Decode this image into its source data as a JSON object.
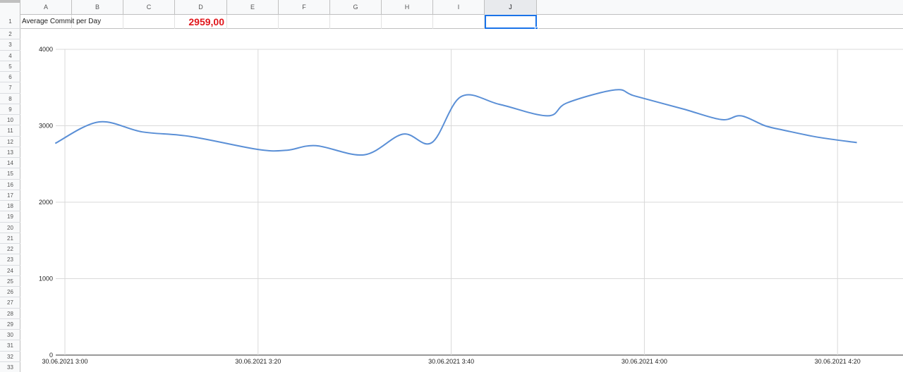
{
  "columns": [
    "A",
    "B",
    "C",
    "D",
    "E",
    "F",
    "G",
    "H",
    "I",
    "J"
  ],
  "selected_column": "J",
  "rows": [
    "1",
    "2",
    "3",
    "4",
    "5",
    "6",
    "7",
    "8",
    "9",
    "10",
    "11",
    "12",
    "13",
    "14",
    "15",
    "16",
    "17",
    "18",
    "19",
    "20",
    "21",
    "22",
    "23",
    "24",
    "25",
    "26",
    "27",
    "28",
    "29",
    "30",
    "31",
    "32",
    "33"
  ],
  "cells": {
    "a1": "Average Commit per Day",
    "d1": "2959,00"
  },
  "colors": {
    "line": "#5a8fd6",
    "highlight_value": "#e0161b",
    "selection": "#1a73e8"
  },
  "chart_data": {
    "type": "line",
    "title": "",
    "xlabel": "",
    "ylabel": "",
    "ylim": [
      0,
      4000
    ],
    "yticks": [
      0,
      1000,
      2000,
      3000,
      4000
    ],
    "xtick_labels": [
      "30.06.2021 3:00",
      "30.06.2021 3:20",
      "30.06.2021 3:40",
      "30.06.2021 4:00",
      "30.06.2021 4:20"
    ],
    "xtick_minutes": [
      0,
      20,
      40,
      60,
      80
    ],
    "grid": true,
    "series": [
      {
        "name": "",
        "x_minutes": [
          -1,
          3.5,
          8,
          13,
          20,
          23,
          26,
          31,
          35,
          38,
          41,
          45,
          50,
          52,
          57,
          59,
          64,
          68,
          70,
          72.5,
          74.5,
          78,
          82
        ],
        "values": [
          2770,
          3050,
          2920,
          2860,
          2690,
          2680,
          2740,
          2620,
          2890,
          2780,
          3380,
          3280,
          3130,
          3300,
          3470,
          3390,
          3220,
          3080,
          3130,
          3000,
          2940,
          2850,
          2780
        ]
      }
    ]
  }
}
